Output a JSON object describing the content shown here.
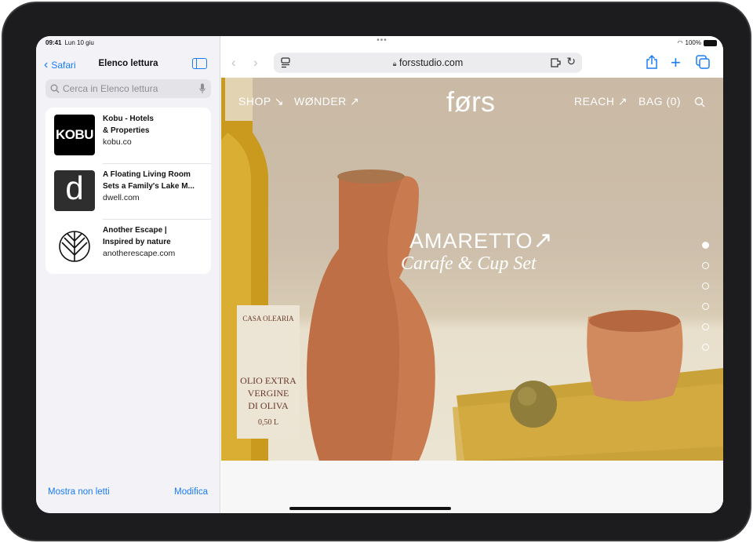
{
  "status": {
    "time": "09:41",
    "date": "Lun 10 giu",
    "battery": "100%"
  },
  "sidebar": {
    "back_label": "Safari",
    "title": "Elenco lettura",
    "search_placeholder": "Cerca in Elenco lettura",
    "items": [
      {
        "title": "Kobu - Hotels & Properties",
        "title_l1": "Kobu - Hotels",
        "title_l2": "& Properties",
        "domain": "kobu.co",
        "thumb": "KOBU"
      },
      {
        "title": "A Floating Living Room Sets a Family's Lake M...",
        "title_l1": "A Floating Living Room",
        "title_l2": "Sets a Family's Lake M...",
        "domain": "dwell.com",
        "thumb": "d"
      },
      {
        "title": "Another Escape | Inspired by nature",
        "title_l1": "Another Escape |",
        "title_l2": "Inspired by nature",
        "domain": "anotherescape.com",
        "thumb": "leaf-logo"
      }
    ],
    "footer_left": "Mostra non letti",
    "footer_right": "Modifica"
  },
  "browser": {
    "url": "forsstudio.com",
    "accent": "#1a7cf5"
  },
  "site": {
    "nav_left": [
      "SHOP ↘",
      "WØNDER ↗"
    ],
    "logo": "førs",
    "nav_right": [
      "REACH ↗",
      "BAG (0)"
    ],
    "hero_title": "AMARETTO",
    "hero_subtitle": "Carafe & Cup Set",
    "slides": 6,
    "active_slide": 1,
    "bottle_label": [
      "CASA OLEARIA",
      "OLIO EXTRA",
      "VERGINE",
      "DI OLIVA",
      "0,50 L"
    ]
  }
}
